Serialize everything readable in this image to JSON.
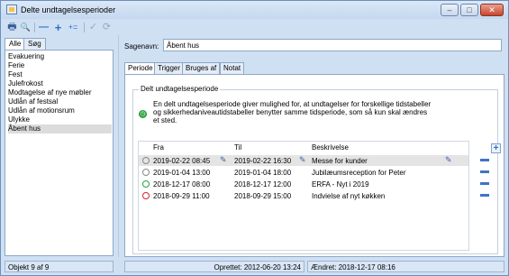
{
  "window": {
    "title": "Delte undtagelsesperioder",
    "min": "–",
    "max": "□",
    "close": "✕"
  },
  "toolbar": {
    "print": "🖶",
    "search": "🔍",
    "remove": "—",
    "add": "+",
    "add_more": "+=",
    "check": "✓",
    "refresh": "⟳"
  },
  "left_tabs": [
    "Alle",
    "Søg"
  ],
  "list": [
    "Evakuering",
    "Ferie",
    "Fest",
    "Julefrokost",
    "Modtagelse af nye møbler",
    "Udlån af festsal",
    "Udlån af motionsrum",
    "Ulykke",
    "Åbent hus"
  ],
  "form": {
    "name_label": "Sagenavn:",
    "name_value": "Åbent hus"
  },
  "tabs": [
    "Periode",
    "Trigger",
    "Bruges af",
    "Notat"
  ],
  "group": {
    "title": "Delt undtagelsesperiode",
    "info": "En delt undtagelsesperiode giver mulighed for, at undtagelser for forskellige tidstabeller og sikkerhedaniveautidstabeller benytter samme tidsperiode, som så kun skal ændres et sted."
  },
  "grid": {
    "headers": [
      "Fra",
      "Til",
      "Beskrivelse"
    ],
    "rows": [
      {
        "from": "2019-02-22  08:45",
        "to": "2019-02-22  16:30",
        "desc": "Messe for kunder",
        "status": "gray"
      },
      {
        "from": "2019-01-04  13:00",
        "to": "2019-01-04  18:00",
        "desc": "Jubilæumsreception for Peter",
        "status": "gray"
      },
      {
        "from": "2018-12-17  08:00",
        "to": "2018-12-17  12:00",
        "desc": "ERFA - Nyt i 2019",
        "status": "green"
      },
      {
        "from": "2018-09-29  11:00",
        "to": "2018-09-29  15:00",
        "desc": "Indvielse af nyt køkken",
        "status": "red"
      }
    ]
  },
  "status": {
    "count": "Objekt 9 af 9",
    "created": "Oprettet: 2012-06-20 13:24",
    "changed": "Ændret: 2018-12-17 08:16"
  },
  "colors": {
    "green": "#22a63a",
    "red": "#d6242b",
    "accent": "#3e74c6"
  }
}
